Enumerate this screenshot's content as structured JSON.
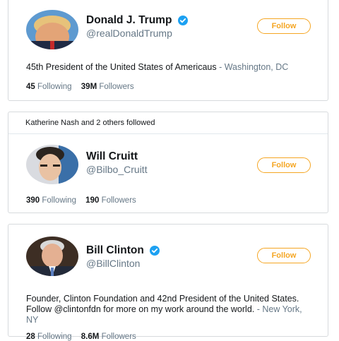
{
  "cards": [
    {
      "name": "Donald J. Trump",
      "handle": "@realDonaldTrump",
      "verified": true,
      "follow_label": "Follow",
      "bio": "45th President of the United States of Americaus",
      "location_sep": " - ",
      "location": "Washington, DC",
      "following_count": "45",
      "following_label": "Following",
      "followers_count": "39M",
      "followers_label": "Followers"
    },
    {
      "context": "Katherine Nash and 2 others followed",
      "name": "Will Cruitt",
      "handle": "@Bilbo_Cruitt",
      "verified": false,
      "follow_label": "Follow",
      "following_count": "390",
      "following_label": "Following",
      "followers_count": "190",
      "followers_label": "Followers"
    },
    {
      "name": "Bill Clinton",
      "handle": "@BillClinton",
      "verified": true,
      "follow_label": "Follow",
      "bio": "Founder, Clinton Foundation and 42nd President of the United States. Follow @clintonfdn for more on my work around the world.",
      "location_sep": " - ",
      "location": "New York, NY",
      "following_count": "28",
      "following_label": "Following",
      "followers_count": "8.6M",
      "followers_label": "Followers"
    }
  ],
  "colors": {
    "accent": "#f5a623",
    "verified": "#1da1f2",
    "muted": "#657786",
    "border": "#d7dadd"
  }
}
